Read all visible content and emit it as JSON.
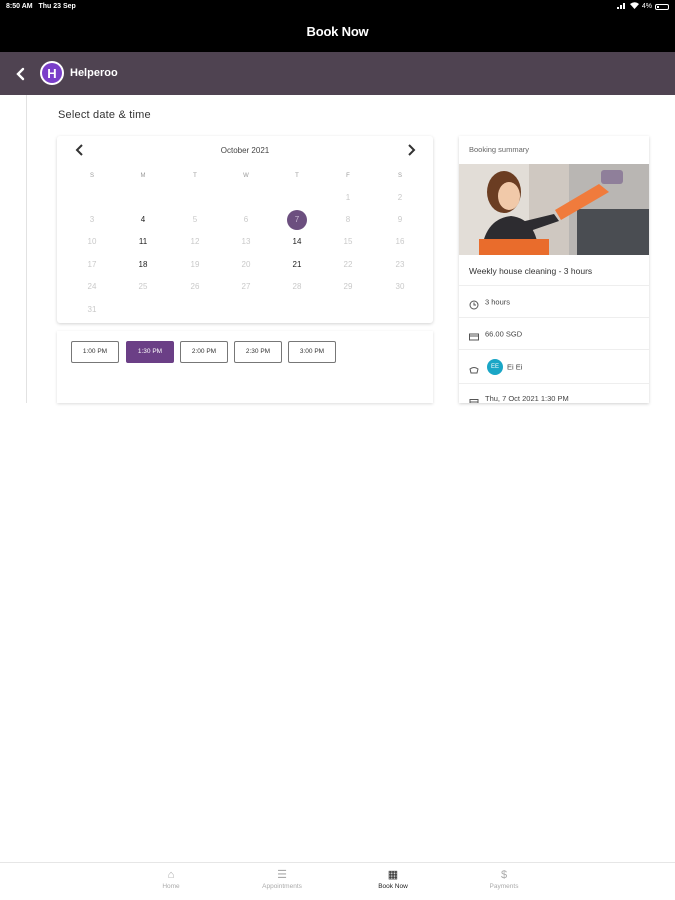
{
  "status_bar": {
    "time": "8:50 AM",
    "date": "Thu 23 Sep",
    "battery": "4%"
  },
  "header": {
    "title": "Book Now"
  },
  "brand": {
    "name": "Helperoo",
    "logo_letter": "H",
    "back_icon": "chevron-left-icon"
  },
  "page": {
    "section_title": "Select date & time"
  },
  "calendar": {
    "month": "October 2021",
    "weekdays": [
      "S",
      "M",
      "T",
      "W",
      "T",
      "F",
      "S"
    ],
    "weeks": [
      [
        null,
        null,
        null,
        null,
        null,
        1,
        2
      ],
      [
        3,
        4,
        5,
        6,
        7,
        8,
        9
      ],
      [
        10,
        11,
        12,
        13,
        14,
        15,
        16
      ],
      [
        17,
        18,
        19,
        20,
        21,
        22,
        23
      ],
      [
        24,
        25,
        26,
        27,
        28,
        29,
        30
      ],
      [
        31,
        null,
        null,
        null,
        null,
        null,
        null
      ]
    ],
    "available_days": [
      4,
      11,
      14,
      18,
      21
    ],
    "selected_day": 7
  },
  "time_slots": {
    "slots": [
      "1:00 PM",
      "1:30 PM",
      "2:00 PM",
      "2:30 PM",
      "3:00 PM"
    ],
    "selected": "1:30 PM"
  },
  "summary": {
    "title": "Booking summary",
    "service": "Weekly house cleaning - 3 hours",
    "duration": "3 hours",
    "price": "66.00 SGD",
    "helper_initials": "EE",
    "helper_name": "Ei Ei",
    "datetime": "Thu, 7 Oct 2021 1:30 PM"
  },
  "tabs": [
    {
      "label": "Home",
      "icon": "home-icon",
      "active": false
    },
    {
      "label": "Appointments",
      "icon": "list-icon",
      "active": false
    },
    {
      "label": "Book Now",
      "icon": "calendar-icon",
      "active": true
    },
    {
      "label": "Payments",
      "icon": "dollar-icon",
      "active": false
    }
  ],
  "colors": {
    "brand_bar": "#4f4351",
    "accent": "#6b3f86",
    "helper_avatar": "#1aa6c6"
  }
}
